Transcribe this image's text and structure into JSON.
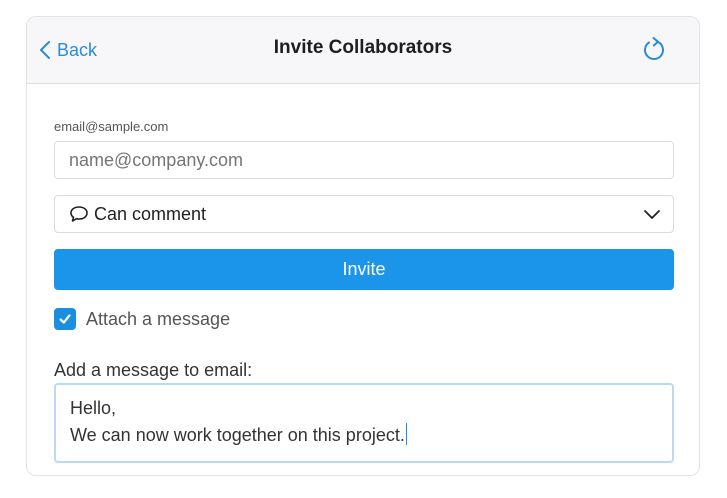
{
  "header": {
    "back_label": "Back",
    "title": "Invite Collaborators",
    "refresh_icon": "refresh-icon"
  },
  "form": {
    "email_label": "email@sample.com",
    "email_placeholder": "name@company.com",
    "permission": {
      "icon": "comment-icon",
      "selected": "Can comment"
    },
    "invite_label": "Invite",
    "attach_message": {
      "checked": true,
      "label": "Attach a message"
    },
    "message_label": "Add a message to email:",
    "message_lines": [
      "Hello,",
      "We can now work together on this project."
    ]
  },
  "colors": {
    "accent": "#1a95ea",
    "link": "#2a8bd8",
    "header_bg": "#f7f7f9"
  }
}
